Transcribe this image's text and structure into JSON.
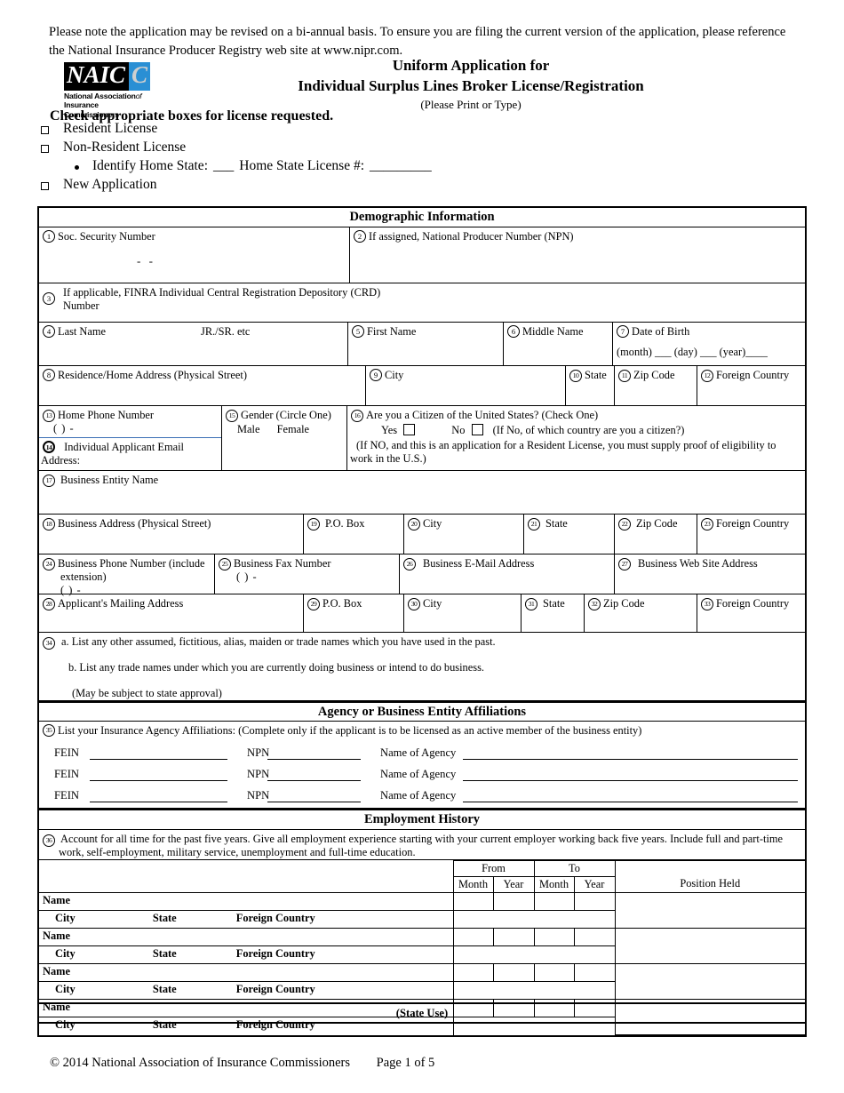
{
  "intro_note": "Please note the application may be revised on a bi-annual basis. To ensure you are filing the current version of the application, please reference the National Insurance Producer Registry web site at www.nipr.com.",
  "logo": {
    "mark_text": "NAIC",
    "line1": "National Association",
    "line1_italic": "of",
    "line2": "Insurance Commissioners",
    "blue_hex": "#2a8fd4"
  },
  "title": {
    "line1": "Uniform Application for",
    "line2": "Individual Surplus Lines Broker License/Registration",
    "line3": "(Please Print or Type)"
  },
  "license_request": {
    "heading": "Check appropriate boxes for license requested.",
    "options": [
      {
        "label": "Resident License"
      },
      {
        "label": "Non-Resident License"
      },
      {
        "label": "New Application"
      }
    ],
    "sub_option": {
      "label_1": "Identify Home State:",
      "blank_1": "___",
      "label_2": "Home State License #:",
      "blank_2": "_________"
    }
  },
  "sections": {
    "demographic": "Demographic Information",
    "agency": "Agency or Business Entity Affiliations",
    "employment": "Employment History",
    "state_use": "(State Use)"
  },
  "fields": {
    "f1": {
      "num": "1",
      "label": "Soc. Security Number",
      "mask": "-            -"
    },
    "f2": {
      "num": "2",
      "label": "If assigned, National Producer Number (NPN)"
    },
    "f3": {
      "num": "3",
      "label_line1": "If applicable, FINRA Individual Central Registration Depository (CRD)",
      "label_line2": "Number"
    },
    "f4": {
      "num": "4",
      "label": "Last Name",
      "suffix": "JR./SR. etc"
    },
    "f5": {
      "num": "5",
      "label": "First Name"
    },
    "f6": {
      "num": "6",
      "label": "Middle Name"
    },
    "f7": {
      "num": "7",
      "label": "Date of Birth",
      "detail": "(month) ___ (day) ___ (year)____"
    },
    "f8": {
      "num": "8",
      "label": "Residence/Home Address  (Physical Street)"
    },
    "f9": {
      "num": "9",
      "label": "City"
    },
    "f10": {
      "num": "10",
      "label": "State"
    },
    "f11": {
      "num": "11",
      "label": "Zip Code"
    },
    "f12": {
      "num": "12",
      "label": "Foreign Country"
    },
    "f13": {
      "num": "13",
      "label": "Home Phone Number",
      "mask": "(        )         -"
    },
    "f14": {
      "num": "14",
      "label_line1": "Individual Applicant Email",
      "label_line2": "Address:"
    },
    "f15": {
      "num": "15",
      "label": "Gender (Circle One)",
      "opt1": "Male",
      "opt2": "Female"
    },
    "f16": {
      "num": "16",
      "label": "Are you a Citizen of the United States? (Check One)",
      "yes": "Yes",
      "no": "No",
      "if_no": "(If No, of which country are you a citizen?)",
      "note_line1": "(If NO, and this is an application for a Resident License, you must supply proof of eligibility to",
      "note_line2": "work in the U.S.)"
    },
    "f17": {
      "num": "17",
      "label": "Business Entity Name"
    },
    "f18": {
      "num": "18",
      "label": "Business Address (Physical Street)"
    },
    "f19": {
      "num": "19",
      "label": "P.O. Box"
    },
    "f20": {
      "num": "20",
      "label": "City"
    },
    "f21": {
      "num": "21",
      "label": "State"
    },
    "f22": {
      "num": "22",
      "label": "Zip Code"
    },
    "f23": {
      "num": "23",
      "label": "Foreign Country"
    },
    "f24": {
      "num": "24",
      "label_line1": "Business Phone Number (include",
      "label_line2": "extension)",
      "mask": "(        )         -"
    },
    "f25": {
      "num": "25",
      "label": "Business Fax Number",
      "mask": "(        )         -"
    },
    "f26": {
      "num": "26",
      "label": "Business E-Mail Address"
    },
    "f27": {
      "num": "27",
      "label": "Business Web Site Address"
    },
    "f28": {
      "num": "28",
      "label": "Applicant's Mailing Address"
    },
    "f29": {
      "num": "29",
      "label": "P.O. Box"
    },
    "f30": {
      "num": "30",
      "label": "City"
    },
    "f31": {
      "num": "31",
      "label": "State"
    },
    "f32": {
      "num": "32",
      "label": "Zip Code"
    },
    "f33": {
      "num": "33",
      "label": "Foreign Country"
    },
    "f34": {
      "num": "34",
      "line_a": "a. List any other assumed, fictitious, alias, maiden or trade names which you have used in the past.",
      "line_b": "b. List any trade names under which you are currently doing business or intend to do business.",
      "line_c": "(May be subject to state approval)"
    },
    "f35": {
      "num": "35",
      "label": "List your Insurance Agency Affiliations: (Complete only if the applicant is to be licensed as an active member of the business entity)",
      "col_fein": "FEIN",
      "col_npn": "NPN",
      "col_agency": "Name of Agency",
      "rows": 3
    },
    "f36": {
      "num": "36",
      "line1": "Account for all time for the past five years.  Give all employment experience starting with your current employer working back five years.  Include full and part-time",
      "line2": "work, self-employment, military service, unemployment and full-time education."
    }
  },
  "employment_table": {
    "group_from": "From",
    "group_to": "To",
    "col_month": "Month",
    "col_year": "Year",
    "col_position": "Position Held",
    "row_name_label": "Name",
    "row_city_label": "City",
    "row_state_label": "State",
    "row_country_label": "Foreign Country",
    "entries": 4
  },
  "footer": {
    "copyright": "© 2014 National Association of Insurance Commissioners",
    "page": "Page 1 of 5"
  }
}
